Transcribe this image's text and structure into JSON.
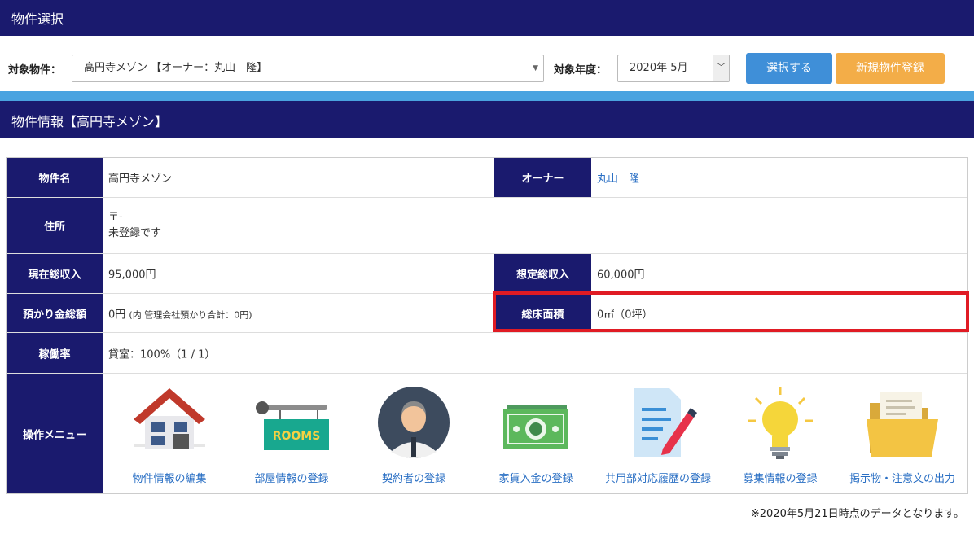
{
  "header": {
    "title": "物件選択"
  },
  "selector": {
    "property_label": "対象物件：",
    "property_value": "高円寺メゾン 【オーナー：丸山　隆】",
    "year_label": "対象年度：",
    "year_value": "2020年 5月",
    "select_button": "選択する",
    "new_button": "新規物件登録"
  },
  "info": {
    "title": "物件情報【高円寺メゾン】",
    "rows": {
      "name_label": "物件名",
      "name_value": "高円寺メゾン",
      "owner_label": "オーナー",
      "owner_value": "丸山　隆",
      "address_label": "住所",
      "address_postal": "〒-",
      "address_value": "未登録です",
      "income_label": "現在総収入",
      "income_value": "95,000円",
      "expected_label": "想定総収入",
      "expected_value": "60,000円",
      "deposit_label": "預かり金総額",
      "deposit_value": "0円",
      "deposit_note": "(内 管理会社預かり合計：0円)",
      "area_label": "総床面積",
      "area_value": "0㎡（0坪）",
      "occupancy_label": "稼働率",
      "occupancy_value": "貸室：100%（1 / 1）",
      "menu_label": "操作メニュー"
    },
    "menu": [
      {
        "label": "物件情報の編集",
        "icon": "house-icon"
      },
      {
        "label": "部屋情報の登録",
        "icon": "rooms-sign-icon",
        "sign_text": "ROOMS"
      },
      {
        "label": "契約者の登録",
        "icon": "person-icon"
      },
      {
        "label": "家賃入金の登録",
        "icon": "money-icon"
      },
      {
        "label": "共用部対応履歴の登録",
        "icon": "document-pen-icon"
      },
      {
        "label": "募集情報の登録",
        "icon": "lightbulb-icon"
      },
      {
        "label": "掲示物・注意文の出力",
        "icon": "folder-icon"
      }
    ]
  },
  "footnote": "※2020年5月21日時点のデータとなります。",
  "colors": {
    "navy": "#1a1a6e",
    "accent_blue": "#4aa3e0",
    "button_blue": "#3f8fd8",
    "button_orange": "#f3ad48",
    "highlight_red": "#e01b24"
  }
}
